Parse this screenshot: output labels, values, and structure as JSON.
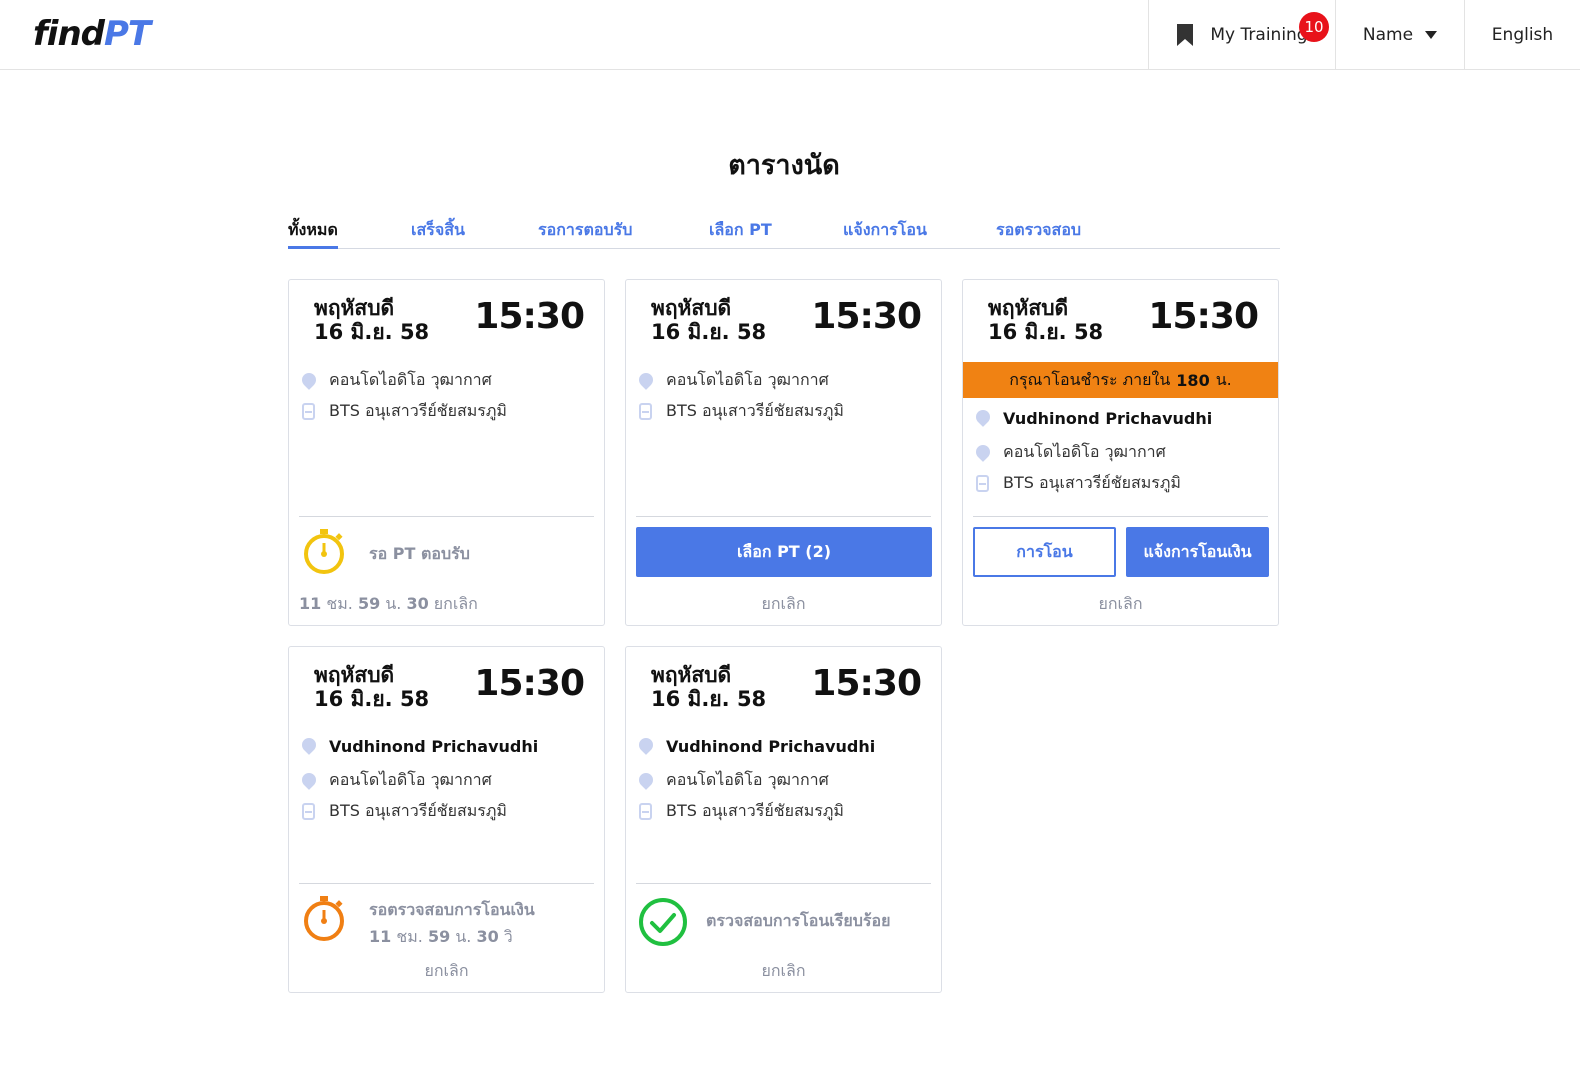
{
  "header": {
    "logo_main": "find",
    "logo_accent": "PT",
    "my_training": "My Training",
    "badge_count": "10",
    "name": "Name",
    "language": "English"
  },
  "page_title": "ตารางนัด",
  "tabs": [
    {
      "label": "ทั้งหมด",
      "active": true
    },
    {
      "label": "เสร็จสิ้น",
      "active": false
    },
    {
      "label": "รอการตอบรับ",
      "active": false
    },
    {
      "label": "เลือก PT",
      "active": false
    },
    {
      "label": "แจ้งการโอน",
      "active": false
    },
    {
      "label": "รอตรวจสอบ",
      "active": false
    }
  ],
  "cards": [
    {
      "day": "พฤหัสบดี",
      "date": "16 มิ.ย. 58",
      "time": "15:30",
      "location": "คอนโดไอดิโอ วุฒากาศ",
      "station": "BTS อนุเสาวรีย์ชัยสมรภูมิ",
      "status": "รอ PT ตอบรับ",
      "countdown": {
        "h": "11",
        "h_unit": "ชม.",
        "m": "59",
        "m_unit": "น.",
        "s": "30",
        "s_unit": "ยกเลิก"
      }
    },
    {
      "day": "พฤหัสบดี",
      "date": "16 มิ.ย. 58",
      "time": "15:30",
      "location": "คอนโดไอดิโอ วุฒากาศ",
      "station": "BTS อนุเสาวรีย์ชัยสมรภูมิ",
      "button": "เลือก PT (2)",
      "cancel": "ยกเลิก"
    },
    {
      "day": "พฤหัสบดี",
      "date": "16 มิ.ย. 58",
      "time": "15:30",
      "banner_prefix": "กรุณาโอนชำระ ภายใน",
      "banner_value": "180",
      "banner_unit": "น.",
      "trainer": "Vudhinond Prichavudhi",
      "location": "คอนโดไอดิโอ วุฒากาศ",
      "station": "BTS อนุเสาวรีย์ชัยสมรภูมิ",
      "button_outline": "การโอน",
      "button": "แจ้งการโอนเงิน",
      "cancel": "ยกเลิก"
    },
    {
      "day": "พฤหัสบดี",
      "date": "16 มิ.ย. 58",
      "time": "15:30",
      "trainer": "Vudhinond Prichavudhi",
      "location": "คอนโดไอดิโอ วุฒากาศ",
      "station": "BTS อนุเสาวรีย์ชัยสมรภูมิ",
      "status": "รอตรวจสอบการโอนเงิน",
      "countdown": {
        "h": "11",
        "h_unit": "ชม.",
        "m": "59",
        "m_unit": "น.",
        "s": "30",
        "s_unit": "วิ"
      },
      "cancel": "ยกเลิก"
    },
    {
      "day": "พฤหัสบดี",
      "date": "16 มิ.ย. 58",
      "time": "15:30",
      "trainer": "Vudhinond Prichavudhi",
      "location": "คอนโดไอดิโอ วุฒากาศ",
      "station": "BTS อนุเสาวรีย์ชัยสมรภูมิ",
      "status": "ตรวจสอบการโอนเรียบร้อย",
      "cancel": "ยกเลิก"
    }
  ],
  "colors": {
    "accent": "#4a78e6",
    "banner": "#f08213",
    "timer_yellow": "#f2c40f",
    "timer_orange": "#f07f13",
    "check_green": "#20c040",
    "badge_red": "#e8121a"
  }
}
